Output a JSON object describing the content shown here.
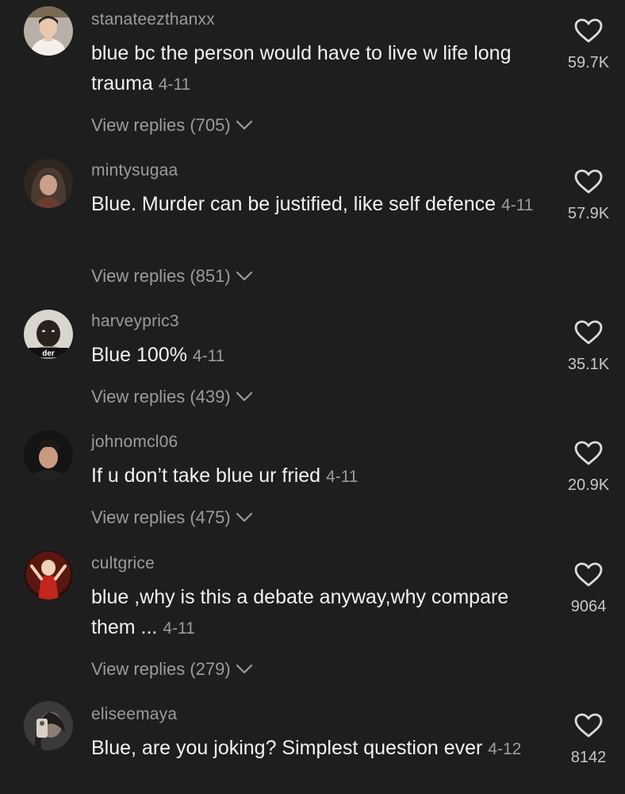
{
  "comments": [
    {
      "username": "stanateezthanxx",
      "text": "blue bc the person would have to live w life long trauma",
      "date": "4-11",
      "replies": "View replies (705)",
      "likes": "59.7K",
      "avatar": "person-white-shirt-avatar",
      "avatar_colors": [
        "#b8b0a6",
        "#f4f1ec"
      ]
    },
    {
      "username": "mintysugaa",
      "text": "Blue. Murder can be justified, like self defence",
      "date": "4-11",
      "replies": "View replies (851)",
      "likes": "57.9K",
      "avatar": "person-long-hair-avatar",
      "avatar_colors": [
        "#4a3a30",
        "#c9a089"
      ]
    },
    {
      "username": "harveypric3",
      "text": "Blue 100%",
      "date": "4-11",
      "replies": "View replies (439)",
      "likes": "35.1K",
      "avatar": "person-meme-avatar",
      "avatar_caption": "der",
      "avatar_colors": [
        "#d9d6cf",
        "#2b211c"
      ]
    },
    {
      "username": "johnomcl06",
      "text": "If u don’t take blue ur fried",
      "date": "4-11",
      "replies": "View replies (475)",
      "likes": "20.9K",
      "avatar": "person-dark-hair-avatar",
      "avatar_colors": [
        "#1c1a18",
        "#c99a82"
      ]
    },
    {
      "username": "cultgrice",
      "text": "blue ,why is this a debate anyway,why compare them ...",
      "date": "4-11",
      "replies": "View replies (279)",
      "likes": "9064",
      "avatar": "doll-red-avatar",
      "avatar_colors": [
        "#c2261d",
        "#f0d2b6"
      ]
    },
    {
      "username": "eliseemaya",
      "text": "Blue, are you joking? Simplest question ever",
      "date": "4-12",
      "likes": "8142",
      "avatar": "person-phone-selfie-avatar",
      "avatar_colors": [
        "#3a3a3c",
        "#d8d0c8"
      ]
    }
  ]
}
